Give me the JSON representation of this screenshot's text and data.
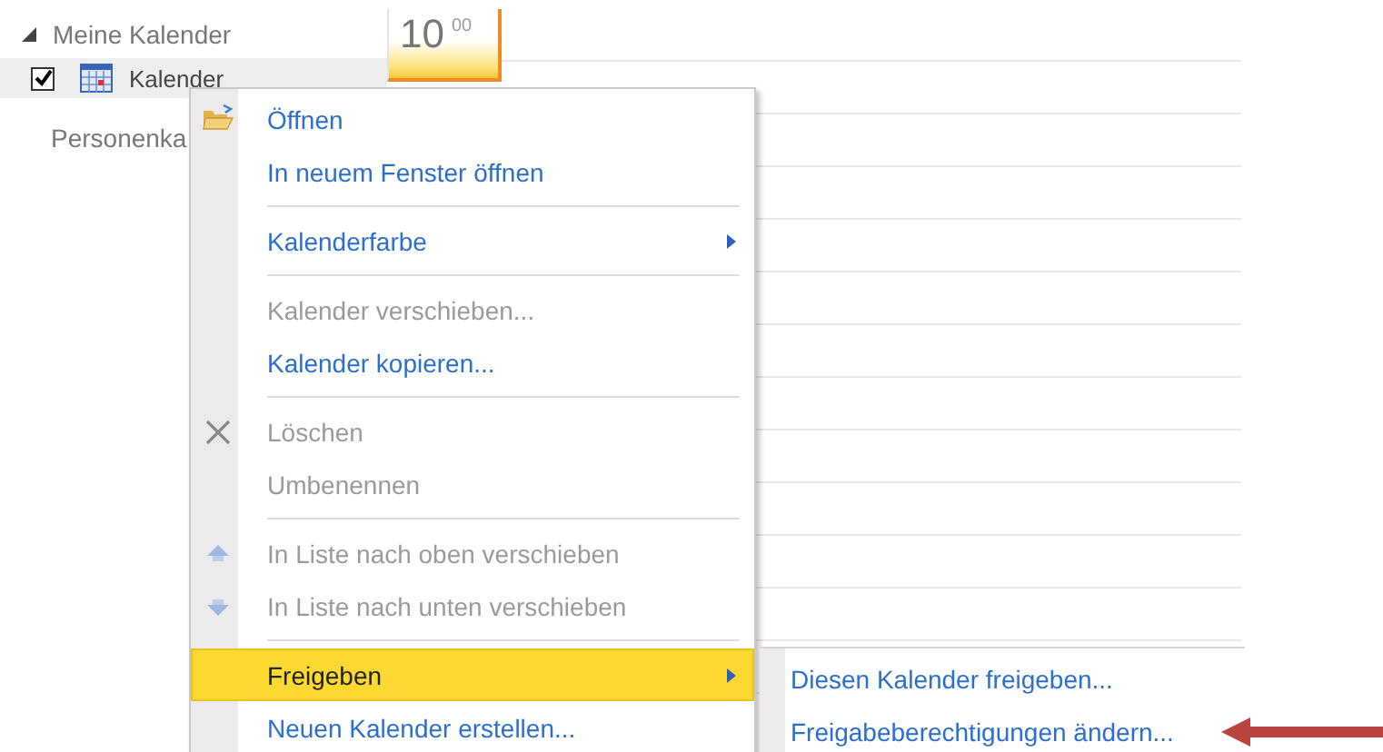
{
  "sidebar": {
    "group": {
      "label": "Meine Kalender",
      "expanded": true
    },
    "calendars": [
      {
        "label": "Kalender",
        "checked": true,
        "selected": true
      }
    ],
    "other_group": {
      "label": "Personenka"
    }
  },
  "day_view": {
    "hour": "10",
    "minutes": "00"
  },
  "context_menu": {
    "items": [
      {
        "kind": "open",
        "label": "Öffnen",
        "disabled": false,
        "selected": false,
        "submenu": false
      },
      {
        "kind": "plain",
        "label": "In neuem Fenster öffnen",
        "disabled": false,
        "selected": false,
        "submenu": false
      },
      {
        "kind": "separator"
      },
      {
        "kind": "plain",
        "label": "Kalenderfarbe",
        "disabled": false,
        "selected": false,
        "submenu": true
      },
      {
        "kind": "separator"
      },
      {
        "kind": "plain",
        "label": "Kalender verschieben...",
        "disabled": true,
        "selected": false,
        "submenu": false
      },
      {
        "kind": "plain",
        "label": "Kalender kopieren...",
        "disabled": false,
        "selected": false,
        "submenu": false
      },
      {
        "kind": "separator"
      },
      {
        "kind": "delete",
        "label": "Löschen",
        "disabled": true,
        "selected": false,
        "submenu": false
      },
      {
        "kind": "plain",
        "label": "Umbenennen",
        "disabled": true,
        "selected": false,
        "submenu": false
      },
      {
        "kind": "separator"
      },
      {
        "kind": "up",
        "label": "In Liste nach oben verschieben",
        "disabled": true,
        "selected": false,
        "submenu": false
      },
      {
        "kind": "down",
        "label": "In Liste nach unten verschieben",
        "disabled": true,
        "selected": false,
        "submenu": false
      },
      {
        "kind": "separator"
      },
      {
        "kind": "plain",
        "label": "Freigeben",
        "disabled": false,
        "selected": true,
        "submenu": true
      },
      {
        "kind": "plain",
        "label": "Neuen Kalender erstellen...",
        "disabled": false,
        "selected": false,
        "submenu": false
      }
    ]
  },
  "submenu": {
    "items": [
      {
        "label": "Diesen Kalender freigeben...",
        "selected": false
      },
      {
        "label": "Freigabeberechtigungen ändern...",
        "selected": false
      }
    ]
  },
  "annotation": {
    "kind": "arrow"
  }
}
